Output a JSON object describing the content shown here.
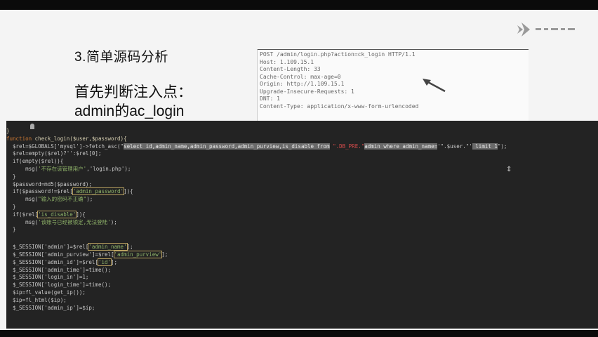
{
  "slide": {
    "title": "3.简单源码分析",
    "subtitle_line1": "首先判断注入点：",
    "subtitle_line2": "admin的ac_login"
  },
  "http_request": [
    "POST /admin/login.php?action=ck_login HTTP/1.1",
    "Host: 1.109.15.1",
    "Content-Length: 33",
    "Cache-Control: max-age=0",
    "Origin: http://1.109.15.1",
    "Upgrade-Insecure-Requests: 1",
    "DNT: 1",
    "Content-Type: application/x-www-form-urlencoded"
  ],
  "code": {
    "l01": "}",
    "l02_kw": "function ",
    "l02_fn": "check_login",
    "l02_rest": "($user,$password){",
    "l03_a": "  $rel=$GLOBALS['mysql']->fetch_asc(\"",
    "l03_hl": "select id,admin_name,admin_password,admin_purview,is_disable from",
    "l03_b": " \".DB_PRE.\"",
    "l03_hl2": "admin where admin_name=",
    "l03_c": "'\".$user.\"'",
    "l03_hl3": " limit 1",
    "l03_d": "\");",
    "l04": "  $rel=empty($rel)?'':$rel[0];",
    "l05": "  if(empty($rel)){",
    "l06_a": "      msg(",
    "l06_str": "'不存在该管理用户'",
    "l06_b": ",'login.php');",
    "l07": "  }",
    "l08": "  $password=md5($password);",
    "l09_a": "  if($password!=$rel[",
    "l09_box": "'admin_password'",
    "l09_b": "]){",
    "l10_a": "      msg(",
    "l10_str": "\"输入的密码不正确\"",
    "l10_b": ");",
    "l11": "  }",
    "l12_a": "  if($rel[",
    "l12_box": "'is_disable'",
    "l12_b": "]){",
    "l13_a": "      msg(",
    "l13_str": "'该账号已经被锁定,无法登陆'",
    "l13_b": ");",
    "l14": "  }",
    "l15_a": "  $_SESSION['admin']=$rel[",
    "l15_box": "'admin_name'",
    "l15_b": "];",
    "l16_a": "  $_SESSION['admin_purview']=$rel[",
    "l16_box": "'admin_purview'",
    "l16_b": "];",
    "l17_a": "  $_SESSION['admin_id']=$rel[",
    "l17_box": "'id'",
    "l17_b": "];",
    "l18": "  $_SESSION['admin_time']=time();",
    "l19": "  $_SESSION['login_in']=1;",
    "l20": "  $_SESSION['login_time']=time();",
    "l21": "  $ip=fl_value(get_ip());",
    "l22": "  $ip=fl_html($ip);",
    "l23": "  $_SESSION['admin_ip']=$ip;"
  },
  "colors": {
    "slide_bg": "#f4f4f4",
    "code_bg": "#232323",
    "keyword": "#cc7833",
    "string": "#8fb369"
  },
  "icons": [
    "logo-icon",
    "arrow-icon",
    "cursor-icon"
  ]
}
